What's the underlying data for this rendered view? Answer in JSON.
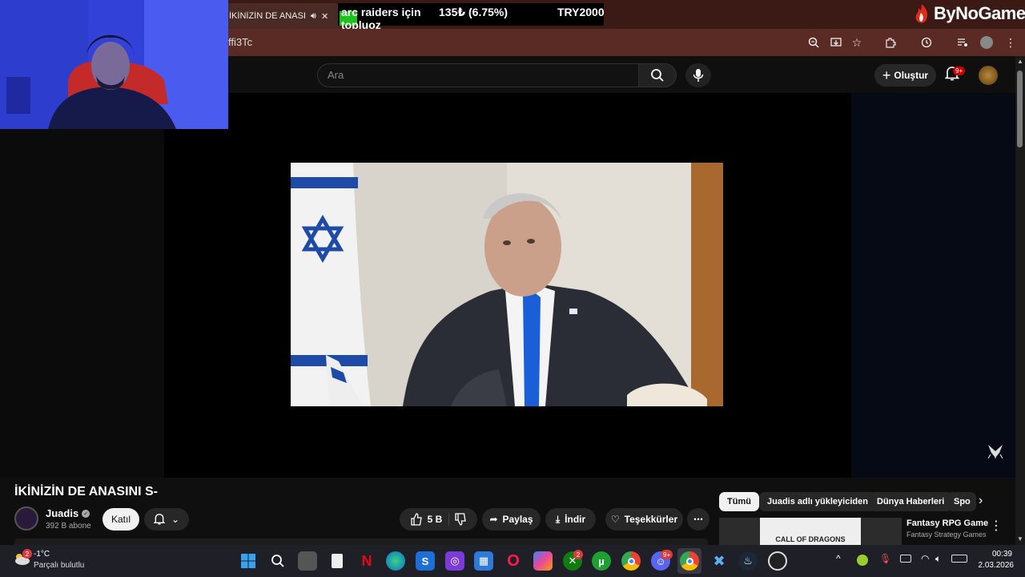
{
  "browser": {
    "tab_title": "İKİNİZİN DE ANASINI",
    "url_fragment": "ffi3Tc"
  },
  "ticker": {
    "item_name": "arc raiders için toploz",
    "item_name_line2": "topluoz",
    "change": "135₺ (6.75%)",
    "total": "TRY2000"
  },
  "brand": {
    "name": "ByNoGame"
  },
  "youtube": {
    "search_placeholder": "Ara",
    "create_label": "Oluştur",
    "notif_badge": "9+",
    "video_title": "İKİNİZİN DE ANASINI S-",
    "channel_name": "Juadis",
    "subscribers": "392 B abone",
    "join_label": "Katıl",
    "likes": "5 B",
    "share_label": "Paylaş",
    "download_label": "İndir",
    "thanks_label": "Teşekkürler",
    "chips": [
      "Tümü",
      "Juadis adlı yükleyiciden",
      "Dünya Haberleri",
      "Spo"
    ],
    "rec_title": "Fantasy RPG Game",
    "rec_channel": "Fantasy Strategy Games",
    "rec_thumb_text": "CALL OF DRAGONS"
  },
  "taskbar": {
    "weather_temp": "-1°C",
    "weather_desc": "Parçalı bulutlu",
    "weather_badge": "2",
    "time": "00:39",
    "date": "2.03.2026",
    "xbox_badge": "2",
    "discord_badge": "9+"
  },
  "colors": {
    "tabstrip": "#3b1a16",
    "addressbar": "#5a2b24",
    "yt_bg": "#0f0f0f",
    "webcam_blue": "#3d50e6",
    "ticker_green": "#1ec11e"
  }
}
